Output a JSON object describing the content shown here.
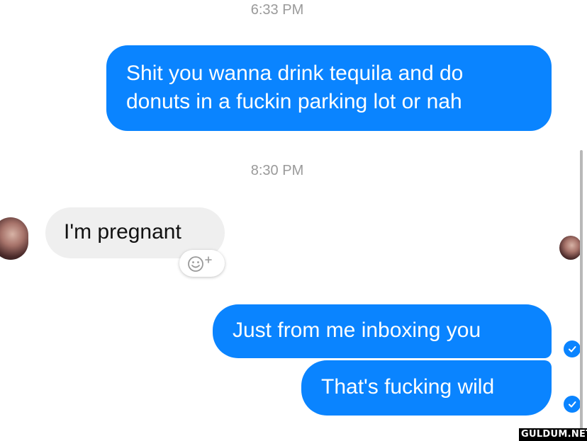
{
  "conversation": {
    "timestamps": [
      "6:33 PM",
      "8:30 PM"
    ],
    "messages": [
      {
        "direction": "outgoing",
        "text": "Shit you wanna drink tequila and do donuts in a fuckin parking lot or nah"
      },
      {
        "direction": "incoming",
        "text": "I'm pregnant"
      },
      {
        "direction": "outgoing",
        "text": "Just from me inboxing you"
      },
      {
        "direction": "outgoing",
        "text": "That's fucking wild"
      }
    ]
  },
  "icons": {
    "react": "smiley-plus-icon",
    "read_receipt": "check-circle-icon",
    "avatar": "avatar"
  },
  "colors": {
    "outgoing_bubble": "#0a84ff",
    "incoming_bubble": "#efefef",
    "timestamp": "#9a9a9a"
  },
  "watermark": "GULDUM.NET"
}
